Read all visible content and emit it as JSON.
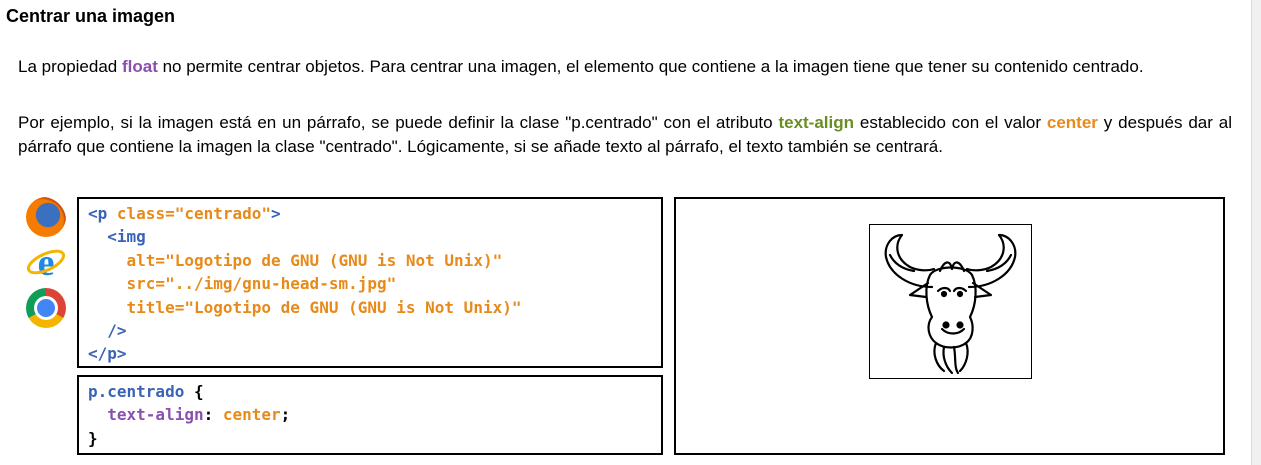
{
  "title": "Centrar una imagen",
  "paragraph1": {
    "pre": "La propiedad ",
    "kw": "float",
    "post": " no permite centrar objetos. Para centrar una imagen, el elemento que contiene a la imagen tiene que tener su contenido centrado."
  },
  "paragraph2": {
    "pre": "Por ejemplo, si la imagen está en un párrafo, se puede definir la clase \"p.centrado\" con el atributo ",
    "kw1": "text-align",
    "mid": " establecido con el valor ",
    "kw2": "center",
    "post": " y después dar al párrafo que contiene la imagen la clase \"centrado\". Lógicamente, si se añade texto al párrafo, el texto también se centrará."
  },
  "browsers": [
    "firefox-icon",
    "internet-explorer-icon",
    "chrome-icon"
  ],
  "html_code": {
    "l1_open": "<p ",
    "l1_attr": "class=",
    "l1_val": "\"centrado\"",
    "l1_close": ">",
    "l2_tag": "  <img",
    "l3_attr": "    alt=",
    "l3_val": "\"Logotipo de GNU (GNU is Not Unix)\"",
    "l4_attr": "    src=",
    "l4_val": "\"../img/gnu-head-sm.jpg\"",
    "l5_attr": "    title=",
    "l5_val": "\"Logotipo de GNU (GNU is Not Unix)\"",
    "l6": "  />",
    "l7": "</p>"
  },
  "css_code": {
    "selector": "p.centrado",
    "open": " {",
    "indent": "  ",
    "property": "text-align",
    "colon": ": ",
    "value": "center",
    "semi": ";",
    "close": "}"
  },
  "result": {
    "image_alt": "Logotipo de GNU (GNU is Not Unix)"
  }
}
